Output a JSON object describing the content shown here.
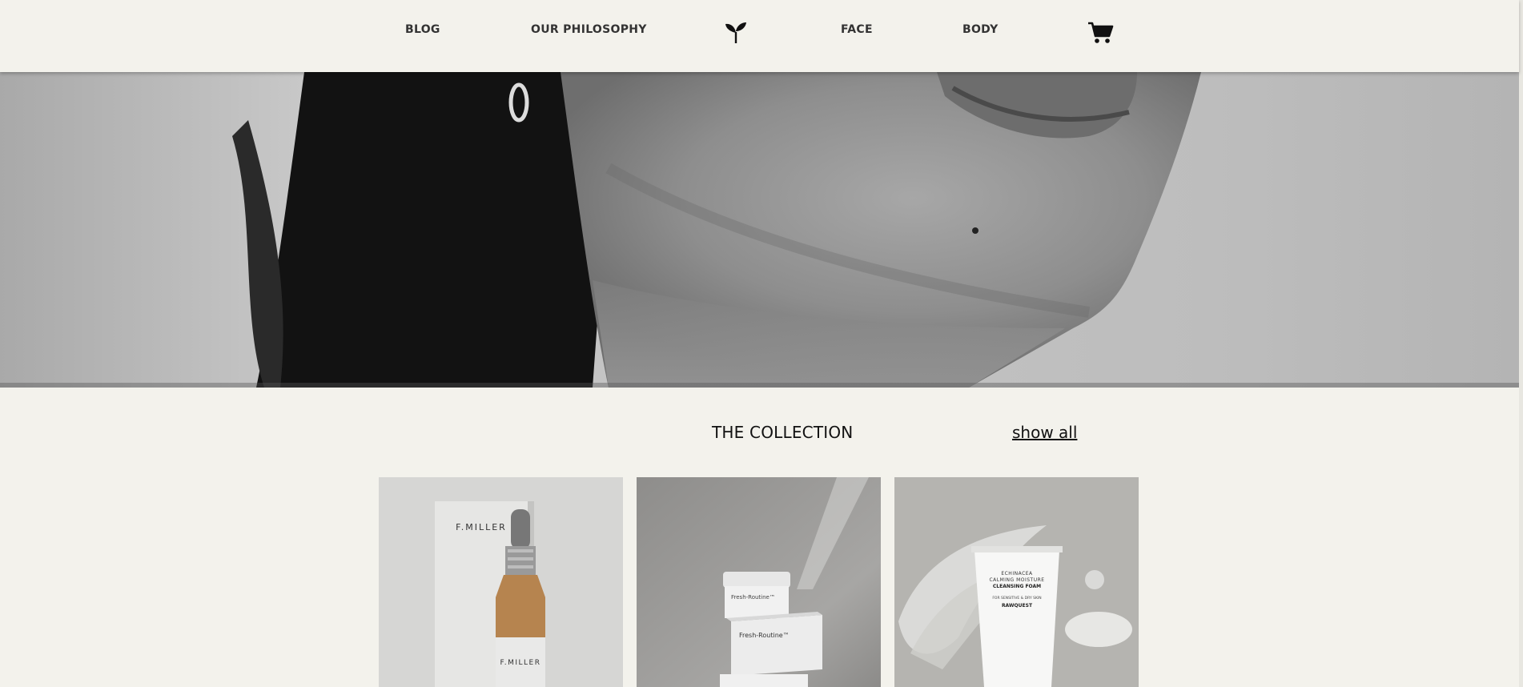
{
  "nav": {
    "blog": "BLOG",
    "philosophy": "OUR PHILOSOPHY",
    "face": "FACE",
    "body": "BODY",
    "logo_icon": "sprout-icon",
    "cart_icon": "cart-icon"
  },
  "collection": {
    "title": "THE COLLECTION",
    "show_all": "show all"
  },
  "products": [
    {
      "brand": "F.MILLER",
      "label": "F.MILLER"
    },
    {
      "brand": "Fresh-Routine™",
      "label": "Fresh-Routine™"
    },
    {
      "line1": "ECHINACEA",
      "line2": "CALMING MOISTURE",
      "line3": "CLEANSING FOAM",
      "line4": "FOR SENSITIVE & DRY SKIN",
      "brand": "RAWQUEST"
    }
  ],
  "colors": {
    "background": "#f3f2ec",
    "text": "#1a1a1a"
  }
}
